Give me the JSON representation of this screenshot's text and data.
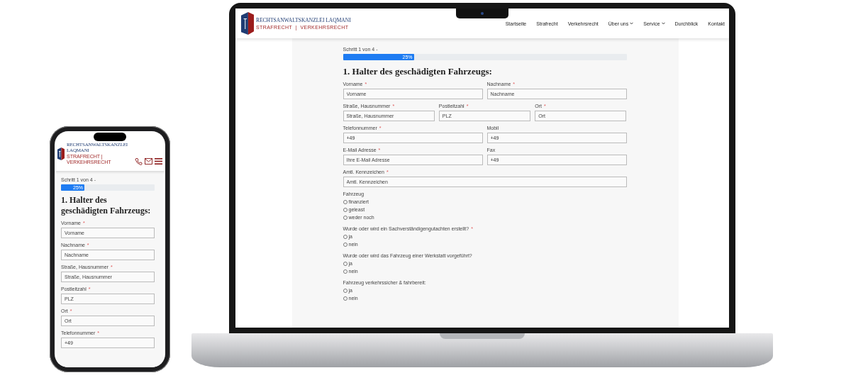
{
  "laptop": {
    "header": {
      "logo": {
        "name": "RECHTSANWALTSKANZLEI LAQMANI",
        "tagline": "STRAFRECHT  |  VERKEHRSRECHT"
      },
      "nav": [
        {
          "label": "Startseite",
          "dropdown": false
        },
        {
          "label": "Strafrecht",
          "dropdown": false
        },
        {
          "label": "Verkehrsrecht",
          "dropdown": false
        },
        {
          "label": "Über uns",
          "dropdown": true
        },
        {
          "label": "Service",
          "dropdown": true
        },
        {
          "label": "Durchblick",
          "dropdown": false
        },
        {
          "label": "Kontakt",
          "dropdown": false
        }
      ]
    },
    "form": {
      "step": "Schritt 1 von 4 -",
      "progress": {
        "level": 0.25,
        "reading": "25%"
      },
      "heading": "1. Halter des geschädigten Fahrzeugs:",
      "rows": [
        [
          {
            "label": "Vorname",
            "required_marker": "*",
            "placeholder": "Vorname"
          },
          {
            "label": "Nachname",
            "required_marker": "*",
            "placeholder": "Nachname"
          }
        ],
        [
          {
            "label": "Straße, Hausnummer",
            "required_marker": "*",
            "placeholder": "Straße, Hausnummer"
          },
          {
            "label": "Postleitzahl",
            "required_marker": "*",
            "placeholder": "PLZ"
          },
          {
            "label": "Ort",
            "required_marker": "*",
            "placeholder": "Ort"
          }
        ],
        [
          {
            "label": "Telefonnummer",
            "required_marker": "*",
            "value": "+49"
          },
          {
            "label": "Mobil",
            "value": "+49"
          }
        ],
        [
          {
            "label": "E-Mail Adresse",
            "required_marker": "*",
            "placeholder": "Ihre E-Mail Adresse"
          },
          {
            "label": "Fax",
            "value": "+49"
          }
        ],
        [
          {
            "label": "Amtl. Kennzeichen",
            "required_marker": "*",
            "placeholder": "Amtl. Kennzeichen"
          }
        ]
      ],
      "radio_groups": [
        {
          "question": "Fahrzeug",
          "options": [
            {
              "label": "finanziert",
              "selected": false
            },
            {
              "label": "geleast",
              "selected": false
            },
            {
              "label": "weder noch",
              "selected": false
            }
          ]
        },
        {
          "question": "Wurde oder wird ein Sachverständigengutachten erstellt?",
          "required_marker": "*",
          "options": [
            {
              "label": "ja",
              "selected": false
            },
            {
              "label": "nein",
              "selected": false
            }
          ]
        },
        {
          "question": "Wurde oder wird das Fahrzeug einer Werkstatt vorgeführt?",
          "options": [
            {
              "label": "ja",
              "selected": false
            },
            {
              "label": "nein",
              "selected": false
            }
          ]
        },
        {
          "question": "Fahrzeug verkehrssicher & fahrbereit:",
          "options": [
            {
              "label": "ja",
              "selected": false
            },
            {
              "label": "nein",
              "selected": false
            }
          ]
        }
      ]
    }
  },
  "phone": {
    "header": {
      "logo": {
        "name": "RECHTSANWALTSKANZLEI LAQMANI",
        "tagline": "STRAFRECHT  |  VERKEHRSRECHT"
      }
    },
    "form": {
      "step": "Schritt 1 von 4 -",
      "progress": {
        "level": 0.25,
        "reading": "25%"
      },
      "heading": "1. Halter des geschädigten Fahrzeugs:",
      "rows": [
        [
          {
            "label": "Vorname",
            "required_marker": "*",
            "placeholder": "Vorname"
          }
        ],
        [
          {
            "label": "Nachname",
            "required_marker": "*",
            "placeholder": "Nachname"
          }
        ],
        [
          {
            "label": "Straße, Hausnummer",
            "required_marker": "*",
            "placeholder": "Straße, Hausnummer"
          }
        ],
        [
          {
            "label": "Postleitzahl",
            "required_marker": "*",
            "placeholder": "PLZ"
          }
        ],
        [
          {
            "label": "Ort",
            "required_marker": "*",
            "placeholder": "Ort"
          }
        ],
        [
          {
            "label": "Telefonnummer",
            "required_marker": "*",
            "value": "+49"
          }
        ]
      ]
    }
  }
}
